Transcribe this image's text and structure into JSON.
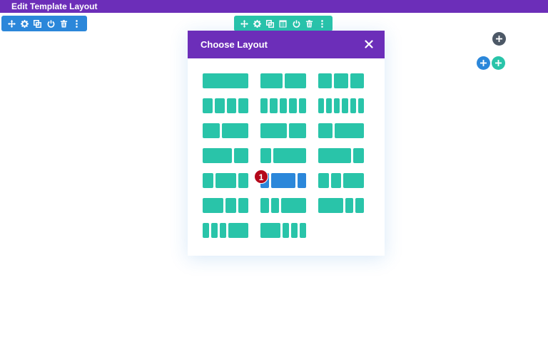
{
  "topbar": {
    "title": "Edit Template Layout"
  },
  "section_toolbar": {
    "icons": [
      "move-icon",
      "gear-icon",
      "duplicate-icon",
      "power-icon",
      "trash-icon",
      "more-icon"
    ],
    "color": "#2b87da"
  },
  "row_toolbar": {
    "icons": [
      "move-icon",
      "gear-icon",
      "duplicate-icon",
      "columns-icon",
      "power-icon",
      "trash-icon",
      "more-icon"
    ],
    "color": "#29c4a9"
  },
  "side_buttons": {
    "dark_icon": "plus-icon",
    "blue_icon": "plus-icon",
    "teal_icon": "plus-icon"
  },
  "modal": {
    "title": "Choose Layout",
    "close_icon": "close-icon",
    "header_color": "#6c2eb9",
    "layout_color": "#29c4a9",
    "hover_color": "#2b87da",
    "layouts": [
      {
        "id": "1",
        "columns": [
          1
        ]
      },
      {
        "id": "1-2_1-2",
        "columns": [
          1,
          1
        ]
      },
      {
        "id": "1-3x3",
        "columns": [
          1,
          1,
          1
        ]
      },
      {
        "id": "1-4x4",
        "columns": [
          1,
          1,
          1,
          1
        ]
      },
      {
        "id": "1-5x5",
        "columns": [
          1,
          1,
          1,
          1,
          1
        ]
      },
      {
        "id": "1-6x6",
        "columns": [
          1,
          1,
          1,
          1,
          1,
          1
        ]
      },
      {
        "id": "2-5_3-5",
        "columns": [
          2,
          3
        ]
      },
      {
        "id": "3-5_2-5",
        "columns": [
          3,
          2
        ]
      },
      {
        "id": "1-3_2-3",
        "columns": [
          1,
          2
        ]
      },
      {
        "id": "2-3_1-3",
        "columns": [
          2,
          1
        ]
      },
      {
        "id": "1-4_3-4",
        "columns": [
          1,
          3
        ]
      },
      {
        "id": "3-4_1-4",
        "columns": [
          3,
          1
        ]
      },
      {
        "id": "1-4_1-2_1-4",
        "columns": [
          1,
          2,
          1
        ]
      },
      {
        "id": "1-5_3-5_1-5",
        "columns": [
          1,
          3,
          1
        ]
      },
      {
        "id": "1-4_1-4_1-2",
        "columns": [
          1,
          1,
          2
        ]
      },
      {
        "id": "1-2_1-4_1-4",
        "columns": [
          2,
          1,
          1
        ]
      },
      {
        "id": "1-5_1-5_3-5",
        "columns": [
          1,
          1,
          3
        ]
      },
      {
        "id": "3-5_1-5_1-5",
        "columns": [
          3,
          1,
          1
        ]
      },
      {
        "id": "1-6_1-6_1-6_1-2",
        "columns": [
          1,
          1,
          1,
          3
        ]
      },
      {
        "id": "1-2_1-6_1-6_1-6",
        "columns": [
          3,
          1,
          1,
          1
        ]
      }
    ],
    "hovered_layout": "1-5_3-5_1-5",
    "step_badge": "1"
  }
}
